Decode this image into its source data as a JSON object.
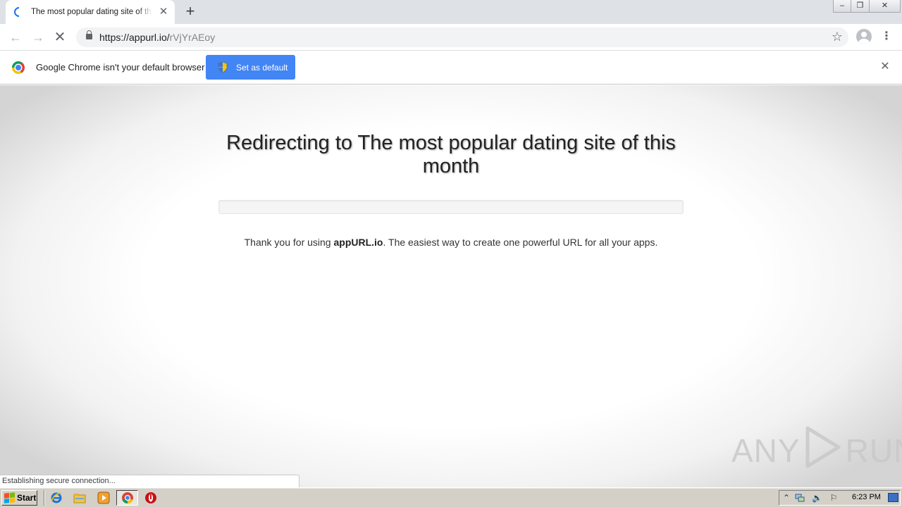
{
  "browser": {
    "tab": {
      "title": "The most popular dating site of this month"
    },
    "address_bar": {
      "url_host": "https://appurl.io/",
      "url_path": "rVjYrAEoy"
    }
  },
  "infobar": {
    "message": "Google Chrome isn't your default browser",
    "button_label": "Set as default"
  },
  "page": {
    "headline": "Redirecting to The most popular dating site of this month",
    "progress_percent": 0,
    "thanks_prefix": "Thank you for using ",
    "brand": "appURL.io",
    "thanks_suffix": ". The easiest way to create one powerful URL for all your apps.",
    "status": "Establishing secure connection...",
    "watermark_left": "ANY",
    "watermark_right": "RUN"
  },
  "taskbar": {
    "start_label": "Start",
    "clock": "6:23 PM",
    "pinned_icons": [
      "internet-explorer-icon",
      "explorer-folder-icon",
      "media-player-icon",
      "chrome-icon",
      "opera-icon"
    ],
    "tray_icons": [
      "show-hidden-icons-chevron",
      "network-icon",
      "volume-icon",
      "action-center-flag-icon"
    ]
  },
  "colors": {
    "accent": "#4285f4",
    "tab_bar": "#dee1e6",
    "taskbar": "#d4d0c8"
  }
}
